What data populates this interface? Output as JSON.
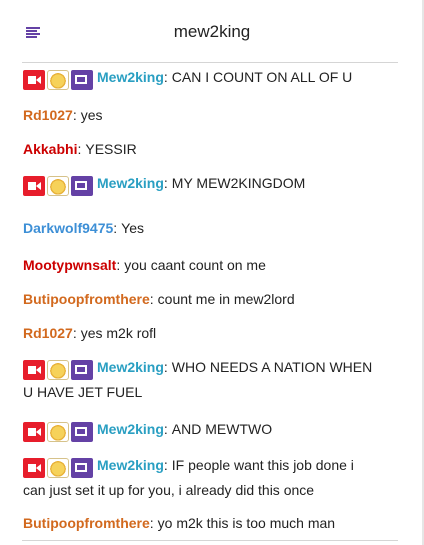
{
  "header": {
    "title": "mew2king"
  },
  "colors": {
    "mew2king": "#2a9fc2",
    "orange": "#d2691e",
    "red": "#cc0000",
    "blue": "#3d8fd6",
    "accent": "#6441a5"
  },
  "messages": [
    {
      "user": "Mew2king",
      "text": "CAN I COUNT ON ALL OF U",
      "badges": true,
      "color": "#2a9fc2"
    },
    {
      "user": "Rd1027",
      "text": "yes",
      "badges": false,
      "color": "#d2691e"
    },
    {
      "user": "Akkabhi",
      "text": "YESSIR",
      "badges": false,
      "color": "#cc0000"
    },
    {
      "user": "Mew2king",
      "text": "MY MEW2KINGDOM",
      "badges": true,
      "color": "#2a9fc2"
    },
    {
      "user": "Darkwolf9475",
      "text": "Yes",
      "badges": false,
      "color": "#3d8fd6"
    },
    {
      "user": "Mootypwnsalt",
      "text": "you caant count on me",
      "badges": false,
      "color": "#cc0000"
    },
    {
      "user": "Butipoopfromthere",
      "text": "count me in mew2lord",
      "badges": false,
      "color": "#d2691e"
    },
    {
      "user": "Rd1027",
      "text": "yes m2k rofl",
      "badges": false,
      "color": "#d2691e"
    },
    {
      "user": "Mew2king",
      "text": "WHO NEEDS A NATION WHEN U HAVE JET FUEL",
      "badges": true,
      "color": "#2a9fc2"
    },
    {
      "user": "Mew2king",
      "text": "AND MEWTWO",
      "badges": true,
      "color": "#2a9fc2"
    },
    {
      "user": "Mew2king",
      "text": "IF people want this job done i can just set it up for you, i already did this once",
      "badges": true,
      "color": "#2a9fc2"
    },
    {
      "user": "Butipoopfromthere",
      "text": "yo m2k this is too much man",
      "badges": false,
      "color": "#d2691e"
    }
  ]
}
